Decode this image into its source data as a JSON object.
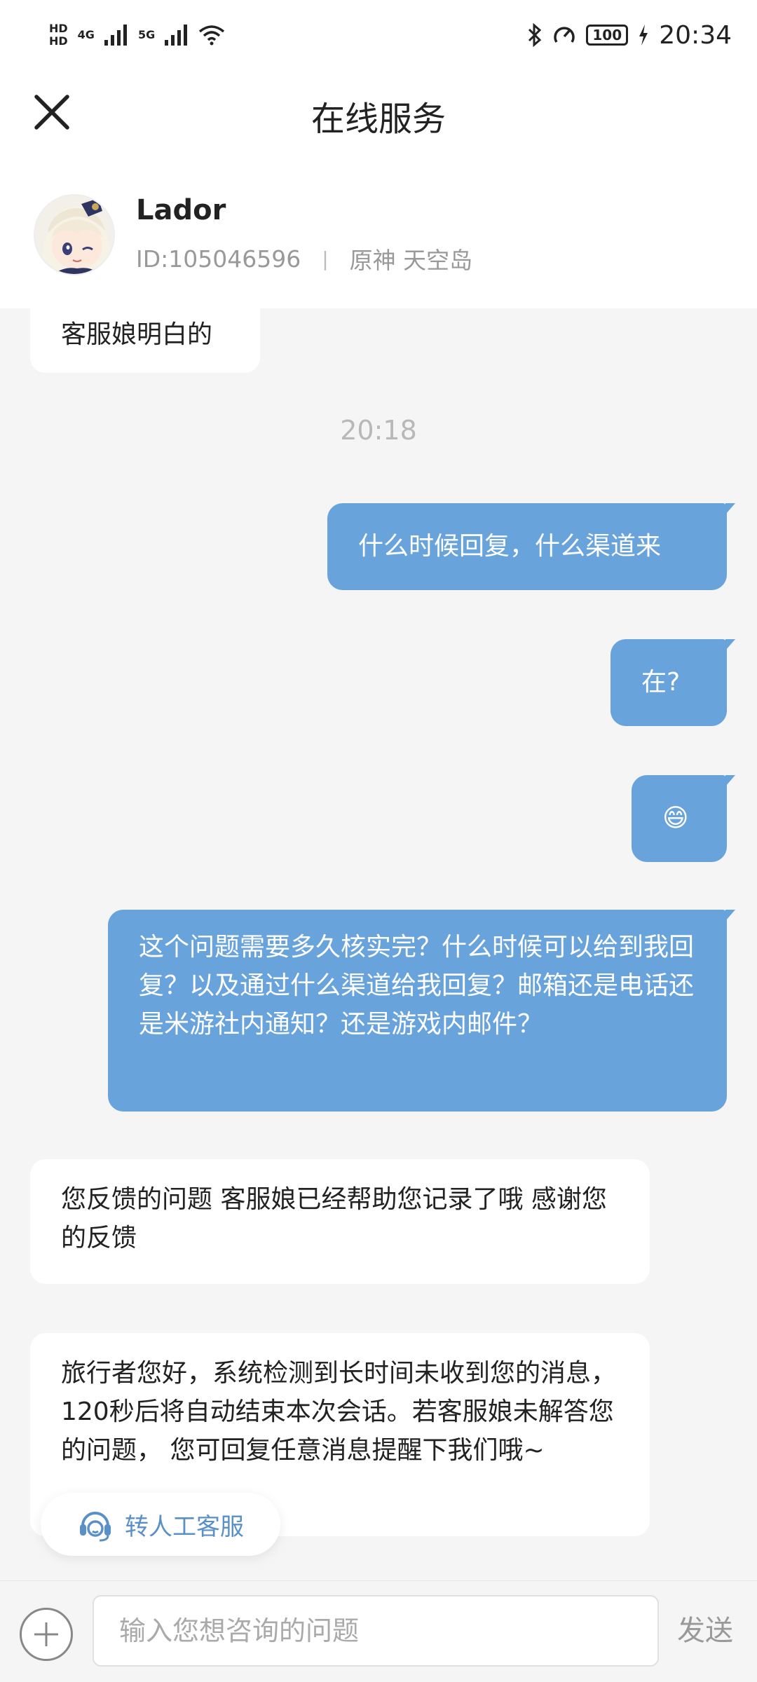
{
  "status_bar": {
    "hd_top": "HD",
    "hd_bottom": "HD",
    "net1": "4G",
    "net2": "5G",
    "battery": "100",
    "time": "20:34"
  },
  "header": {
    "title": "在线服务"
  },
  "profile": {
    "name": "Lador",
    "id": "ID:105046596",
    "server": "原神 天空岛"
  },
  "messages": {
    "m0": "客服娘明白的",
    "time1": "20:18",
    "m1": "什么时候回复，什么渠道来",
    "m2": "在?",
    "m3": "😄",
    "m4": "这个问题需要多久核实完？什么时候可以给到我回复？以及通过什么渠道给我回复？邮箱还是电话还是米游社内通知？还是游戏内邮件？",
    "m5": "您反馈的问题 客服娘已经帮助您记录了哦 感谢您的反馈",
    "m6": "旅行者您好，系统检测到长时间未收到您的消息，120秒后将自动结束本次会话。若客服娘未解答您的问题， 您可回复任意消息提醒下我们哦~"
  },
  "human_service": {
    "label": "转人工客服"
  },
  "input_bar": {
    "placeholder": "输入您想咨询的问题",
    "send_label": "发送"
  },
  "colors": {
    "outgoing_bubble": "#69a3dc",
    "incoming_bubble": "#ffffff",
    "chat_background": "#f5f5f6",
    "accent": "#5a90c8"
  }
}
